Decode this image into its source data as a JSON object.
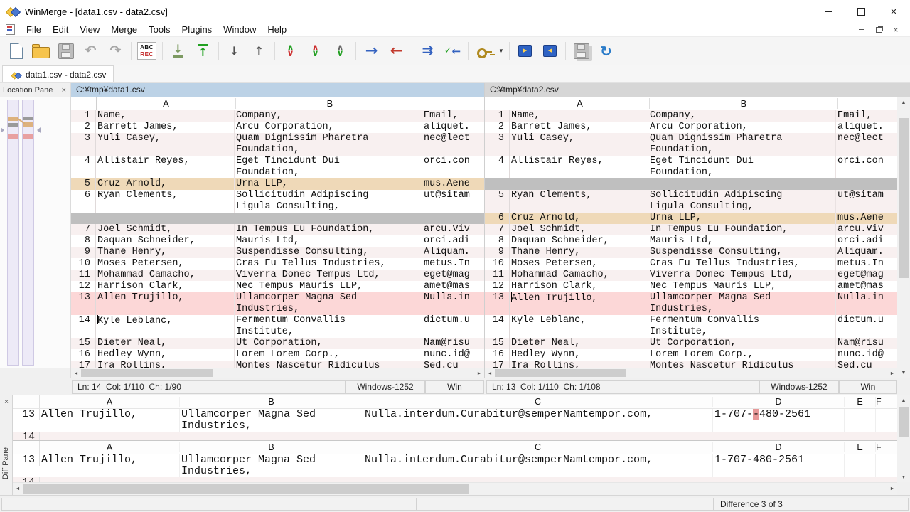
{
  "colors": {
    "diff-row": "#fcd7d7",
    "diff-char": "#e79898",
    "moved-row": "#efd9b8",
    "gap-row": "#bfbfbf",
    "alt-row": "#f8f0f0",
    "active-header": "#bcd2e6",
    "inactive-header": "#d6d6d6"
  },
  "titlebar": {
    "title": "WinMerge - [data1.csv - data2.csv]"
  },
  "menubar": {
    "items": [
      "File",
      "Edit",
      "View",
      "Merge",
      "Tools",
      "Plugins",
      "Window",
      "Help"
    ]
  },
  "toolbar": {
    "abc_top": "ABC",
    "abc_bottom": "REC",
    "items": [
      "new",
      "open",
      "save",
      "undo",
      "redo",
      "abc-rec",
      "next-difference",
      "previous-difference",
      "last-difference",
      "first-difference",
      "next-conflict",
      "previous-conflict",
      "merge-mode",
      "copy-right",
      "copy-left",
      "copy-right-and-advance",
      "auto-merge",
      "plugin",
      "plugin-dropdown",
      "next-file",
      "previous-file",
      "save-all",
      "refresh"
    ]
  },
  "tabbar": {
    "tabs": [
      {
        "label": "data1.csv - data2.csv"
      }
    ]
  },
  "location_pane": {
    "title": "Location Pane"
  },
  "editor": {
    "column_headers": [
      "A",
      "B"
    ]
  },
  "left_pane": {
    "path": "C:¥tmp¥data1.csv",
    "status": {
      "position": "Ln: 14  Col: 1/110  Ch: 1/90",
      "encoding": "Windows-1252",
      "eol": "Win"
    },
    "rows": [
      {
        "n": "1",
        "a": "Name,",
        "b": [
          "Company,"
        ],
        "c": "Email,",
        "type": "normal"
      },
      {
        "n": "2",
        "a": "Barrett James,",
        "b": [
          "Arcu Corporation,"
        ],
        "c": "aliquet.",
        "type": "normal"
      },
      {
        "n": "3",
        "a": "Yuli Casey,",
        "b": [
          "Quam Dignissim Pharetra",
          "Foundation,"
        ],
        "c": "nec@lect",
        "type": "normal"
      },
      {
        "n": "4",
        "a": "Allistair Reyes,",
        "b": [
          "Eget Tincidunt Dui",
          "Foundation,"
        ],
        "c": "orci.con",
        "type": "normal"
      },
      {
        "n": "5",
        "a": "Cruz Arnold,",
        "b": [
          "Urna LLP,"
        ],
        "c": "mus.Aene",
        "type": "moved"
      },
      {
        "n": "6",
        "a": "Ryan Clements,",
        "b": [
          "Sollicitudin Adipiscing",
          "Ligula Consulting,"
        ],
        "c": "ut@sitam",
        "type": "normal"
      },
      {
        "type": "gap"
      },
      {
        "n": "7",
        "a": "Joel Schmidt,",
        "b": [
          "In Tempus Eu Foundation,"
        ],
        "c": "arcu.Viv",
        "type": "normal"
      },
      {
        "n": "8",
        "a": "Daquan Schneider,",
        "b": [
          "Mauris Ltd,"
        ],
        "c": "orci.adi",
        "type": "normal"
      },
      {
        "n": "9",
        "a": "Thane Henry,",
        "b": [
          "Suspendisse Consulting,"
        ],
        "c": "Aliquam.",
        "type": "normal"
      },
      {
        "n": "10",
        "a": "Moses Petersen,",
        "b": [
          "Cras Eu Tellus Industries,"
        ],
        "c": "metus.In",
        "type": "normal"
      },
      {
        "n": "11",
        "a": "Mohammad Camacho,",
        "b": [
          "Viverra Donec Tempus Ltd,"
        ],
        "c": "eget@mag",
        "type": "normal"
      },
      {
        "n": "12",
        "a": "Harrison Clark,",
        "b": [
          "Nec Tempus Mauris LLP,"
        ],
        "c": "amet@mas",
        "type": "normal"
      },
      {
        "n": "13",
        "a": "Allen Trujillo,",
        "b": [
          "Ullamcorper Magna Sed",
          "Industries,"
        ],
        "c": "Nulla.in",
        "type": "diff"
      },
      {
        "n": "14",
        "a": "Kyle Leblanc,",
        "b": [
          "Fermentum Convallis",
          "Institute,"
        ],
        "c": "dictum.u",
        "type": "normal",
        "caret": true
      },
      {
        "n": "15",
        "a": "Dieter Neal,",
        "b": [
          "Ut Corporation,"
        ],
        "c": "Nam@risu",
        "type": "normal"
      },
      {
        "n": "16",
        "a": "Hedley Wynn,",
        "b": [
          "Lorem Lorem Corp.,"
        ],
        "c": "nunc.id@",
        "type": "normal"
      },
      {
        "n": "17",
        "a": "Ira Rollins,",
        "b": [
          "Montes Nascetur Ridiculus"
        ],
        "c": "Sed.cu",
        "type": "normal"
      }
    ]
  },
  "right_pane": {
    "path": "C:¥tmp¥data2.csv",
    "status": {
      "position": "Ln: 13  Col: 1/110  Ch: 1/108",
      "encoding": "Windows-1252",
      "eol": "Win"
    },
    "rows": [
      {
        "n": "1",
        "a": "Name,",
        "b": [
          "Company,"
        ],
        "c": "Email,",
        "type": "normal"
      },
      {
        "n": "2",
        "a": "Barrett James,",
        "b": [
          "Arcu Corporation,"
        ],
        "c": "aliquet.",
        "type": "normal"
      },
      {
        "n": "3",
        "a": "Yuli Casey,",
        "b": [
          "Quam Dignissim Pharetra",
          "Foundation,"
        ],
        "c": "nec@lect",
        "type": "normal"
      },
      {
        "n": "4",
        "a": "Allistair Reyes,",
        "b": [
          "Eget Tincidunt Dui",
          "Foundation,"
        ],
        "c": "orci.con",
        "type": "normal"
      },
      {
        "type": "gap"
      },
      {
        "n": "5",
        "a": "Ryan Clements,",
        "b": [
          "Sollicitudin Adipiscing",
          "Ligula Consulting,"
        ],
        "c": "ut@sitam",
        "type": "normal"
      },
      {
        "n": "6",
        "a": "Cruz Arnold,",
        "b": [
          "Urna LLP,"
        ],
        "c": "mus.Aene",
        "type": "moved"
      },
      {
        "n": "7",
        "a": "Joel Schmidt,",
        "b": [
          "In Tempus Eu Foundation,"
        ],
        "c": "arcu.Viv",
        "type": "normal"
      },
      {
        "n": "8",
        "a": "Daquan Schneider,",
        "b": [
          "Mauris Ltd,"
        ],
        "c": "orci.adi",
        "type": "normal"
      },
      {
        "n": "9",
        "a": "Thane Henry,",
        "b": [
          "Suspendisse Consulting,"
        ],
        "c": "Aliquam.",
        "type": "normal"
      },
      {
        "n": "10",
        "a": "Moses Petersen,",
        "b": [
          "Cras Eu Tellus Industries,"
        ],
        "c": "metus.In",
        "type": "normal"
      },
      {
        "n": "11",
        "a": "Mohammad Camacho,",
        "b": [
          "Viverra Donec Tempus Ltd,"
        ],
        "c": "eget@mag",
        "type": "normal"
      },
      {
        "n": "12",
        "a": "Harrison Clark,",
        "b": [
          "Nec Tempus Mauris LLP,"
        ],
        "c": "amet@mas",
        "type": "normal"
      },
      {
        "n": "13",
        "a": "Allen Trujillo,",
        "b": [
          "Ullamcorper Magna Sed",
          "Industries,"
        ],
        "c": "Nulla.in",
        "type": "diff",
        "caret": true
      },
      {
        "n": "14",
        "a": "Kyle Leblanc,",
        "b": [
          "Fermentum Convallis",
          "Institute,"
        ],
        "c": "dictum.u",
        "type": "normal"
      },
      {
        "n": "15",
        "a": "Dieter Neal,",
        "b": [
          "Ut Corporation,"
        ],
        "c": "Nam@risu",
        "type": "normal"
      },
      {
        "n": "16",
        "a": "Hedley Wynn,",
        "b": [
          "Lorem Lorem Corp.,"
        ],
        "c": "nunc.id@",
        "type": "normal"
      },
      {
        "n": "17",
        "a": "Ira Rollins,",
        "b": [
          "Montes Nascetur Ridiculus"
        ],
        "c": "Sed.cu",
        "type": "normal"
      }
    ]
  },
  "diff_pane": {
    "title": "Diff Pane",
    "columns": [
      "A",
      "B",
      "C",
      "D",
      "E",
      "F"
    ],
    "sections": [
      {
        "rows": [
          {
            "n": "13",
            "a": "Allen Trujillo,",
            "b": [
              "Ullamcorper Magna Sed",
              "Industries,"
            ],
            "c": "Nulla.interdum.Curabitur@semperNamtempor.com,",
            "d_pre": "1-707-",
            "d_hl": "-",
            "d_post": "480-2561"
          },
          {
            "n": "14",
            "partial": true
          }
        ]
      },
      {
        "rows": [
          {
            "n": "13",
            "a": "Allen Trujillo,",
            "b": [
              "Ullamcorper Magna Sed",
              "Industries,"
            ],
            "c": "Nulla.interdum.Curabitur@semperNamtempor.com,",
            "d_pre": "1-707-480-2561",
            "d_hl": "",
            "d_post": ""
          },
          {
            "n": "14",
            "partial": true
          }
        ]
      }
    ]
  },
  "statusbar": {
    "difference": "Difference 3 of 3"
  }
}
